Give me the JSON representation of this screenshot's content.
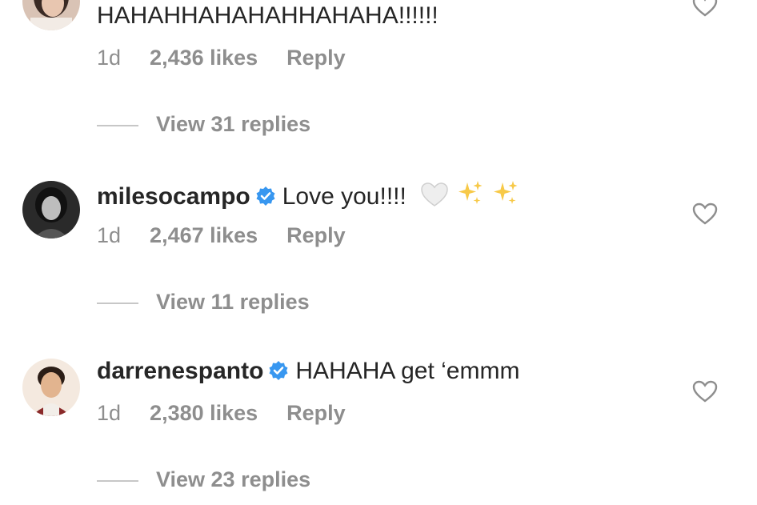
{
  "comments": [
    {
      "username": "",
      "text": "HAHAHHAHAHAHHAHAHA!!!!!!",
      "time": "1d",
      "likes": "2,436 likes",
      "reply": "Reply",
      "view_replies": "View 31 replies",
      "avatar_icon": "user-avatar"
    },
    {
      "username": "milesocampo",
      "text": "Love you!!!!",
      "time": "1d",
      "likes": "2,467 likes",
      "reply": "Reply",
      "view_replies": "View 11 replies",
      "avatar_icon": "user-avatar",
      "emojis": [
        "white-heart-emoji",
        "sparkles-emoji",
        "sparkles-emoji"
      ]
    },
    {
      "username": "darrenespanto",
      "text": "HAHAHA get ‘emmm",
      "time": "1d",
      "likes": "2,380 likes",
      "reply": "Reply",
      "view_replies": "View 23 replies",
      "avatar_icon": "user-avatar"
    }
  ],
  "colors": {
    "text": "#262626",
    "secondary": "#8e8e8e",
    "verified": "#3897f0",
    "divider": "#c7c7c7"
  },
  "icons": [
    "verified-badge-icon",
    "heart-icon"
  ]
}
